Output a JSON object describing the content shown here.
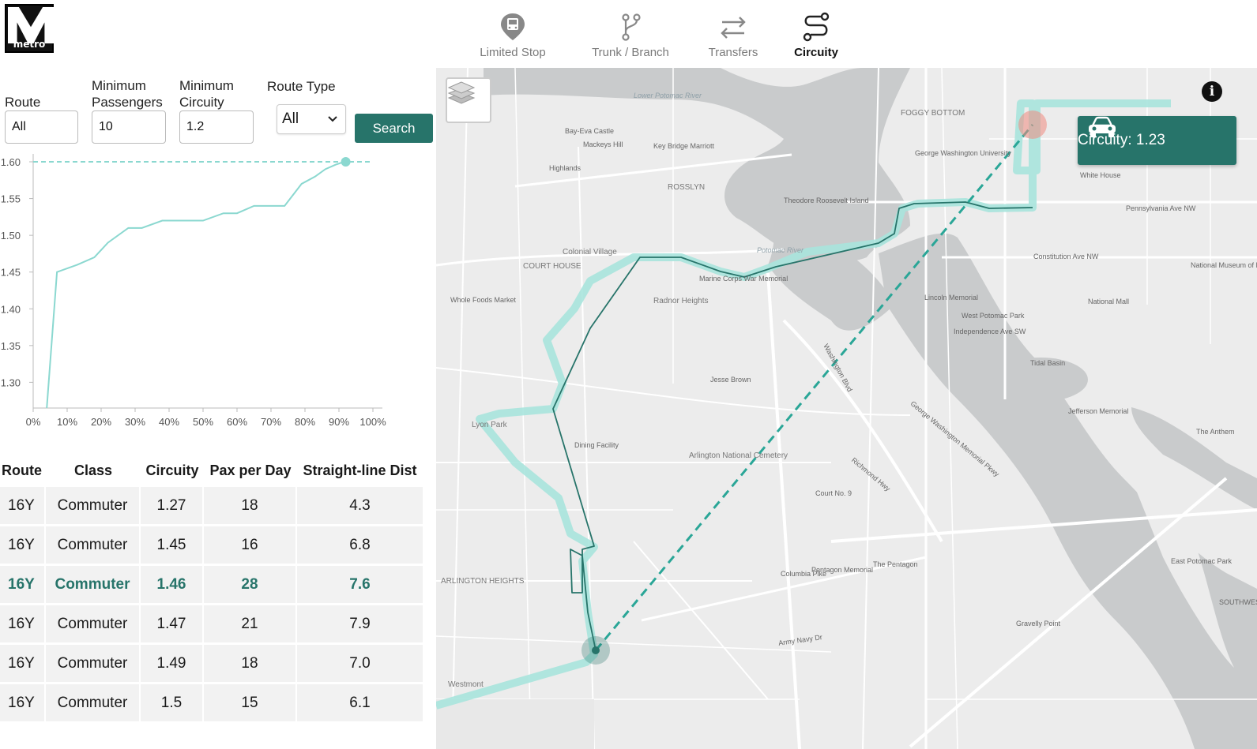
{
  "logo": {
    "letter": "M",
    "word": "metro"
  },
  "nav": [
    {
      "label": "Limited Stop",
      "icon": "bus-stop-pin-icon",
      "active": false
    },
    {
      "label": "Trunk / Branch",
      "icon": "branch-icon",
      "active": false
    },
    {
      "label": "Transfers",
      "icon": "transfer-arrows-icon",
      "active": false
    },
    {
      "label": "Circuity",
      "icon": "circuity-route-icon",
      "active": true
    }
  ],
  "filters": {
    "route_label": "Route",
    "route_value": "All",
    "min_pax_label_1": "Minimum",
    "min_pax_label_2": "Passengers",
    "min_pax_value": "10",
    "min_circ_label_1": "Minimum",
    "min_circ_label_2": "Circuity",
    "min_circ_value": "1.2",
    "route_type_label": "Route Type",
    "route_type_value": "All",
    "search_label": "Search"
  },
  "chart_data": {
    "type": "line",
    "title": "",
    "xlabel": "",
    "ylabel": "",
    "x_ticks": [
      "0%",
      "10%",
      "20%",
      "30%",
      "40%",
      "50%",
      "60%",
      "70%",
      "80%",
      "90%",
      "100%"
    ],
    "y_ticks": [
      "1.30",
      "1.35",
      "1.40",
      "1.45",
      "1.50",
      "1.55",
      "1.60"
    ],
    "xlim": [
      0,
      100
    ],
    "ylim": [
      1.265,
      1.6
    ],
    "grid": false,
    "x": [
      4,
      7,
      13,
      18,
      22,
      28,
      32,
      38,
      43,
      50,
      56,
      60,
      65,
      72,
      74,
      79,
      83,
      86,
      89,
      91.5
    ],
    "values": [
      1.265,
      1.45,
      1.46,
      1.47,
      1.49,
      1.51,
      1.51,
      1.52,
      1.52,
      1.52,
      1.53,
      1.53,
      1.54,
      1.54,
      1.54,
      1.57,
      1.58,
      1.59,
      1.596,
      1.6
    ],
    "reference_line": {
      "y": 1.6,
      "style": "dashed"
    },
    "highlight_point": {
      "x": 92,
      "y": 1.6
    },
    "color": "#8bd8d0"
  },
  "table": {
    "headers": [
      "Route",
      "Class",
      "Circuity",
      "Pax per Day",
      "Straight-line Dist"
    ],
    "rows": [
      [
        "16Y",
        "Commuter",
        "1.27",
        "18",
        "4.3"
      ],
      [
        "16Y",
        "Commuter",
        "1.45",
        "16",
        "6.8"
      ],
      [
        "16Y",
        "Commuter",
        "1.46",
        "28",
        "7.6"
      ],
      [
        "16Y",
        "Commuter",
        "1.47",
        "21",
        "7.9"
      ],
      [
        "16Y",
        "Commuter",
        "1.49",
        "18",
        "7.0"
      ],
      [
        "16Y",
        "Commuter",
        "1.5",
        "15",
        "6.1"
      ]
    ],
    "highlighted_row": 2
  },
  "map": {
    "badge_text": "Circuity: 1.23",
    "labels": {
      "foggy_bottom": "FOGGY BOTTOM",
      "rosslyn": "ROSSLYN",
      "court_house": "COURT HOUSE",
      "arlington_heights": "ARLINGTON HEIGHTS",
      "colonial_village": "Colonial Village",
      "radnor_heights": "Radnor Heights",
      "lyon_park": "Lyon Park",
      "arlington_cemetery": "Arlington National Cemetery",
      "westmont": "Westmont",
      "potomac_river": "Potomac River",
      "lower_potomac": "Lower Potomac River",
      "highlands": "Highlands",
      "lincoln_memorial": "Lincoln Memorial",
      "national_mall": "National Mall",
      "the_pentagon": "The Pentagon",
      "pentagon_memorial": "Pentagon Memorial",
      "tidal_basin": "Tidal Basin",
      "jefferson_memorial": "Jefferson Memorial",
      "theodore_roosevelt": "Theodore Roosevelt Island",
      "marine_corps": "Marine Corps War Memorial",
      "columbia_pike": "Columbia Pike",
      "southwest": "SOUTHWEST",
      "gwu": "George Washington University",
      "white_house": "White House",
      "dining_facility": "Dining Facility",
      "jesse_brown": "Jesse Brown",
      "court_no9": "Court No. 9",
      "whole_foods": "Whole Foods Market",
      "key_bridge_marriott": "Key Bridge Marriott",
      "bay_eva_castle": "Bay-Eva Castle",
      "mackeys_hill": "Mackeys Hill",
      "east_potomac_park": "East Potomac Park",
      "west_potomac_park": "West Potomac Park",
      "national_museum": "National Museum of Natural History",
      "constitution_ave": "Constitution Ave NW",
      "independence_ave": "Independence Ave SW",
      "pennsylvania_ave": "Pennsylvania Ave NW",
      "washington_blvd": "Washington Blvd",
      "richmond_hwy": "Richmond Hwy",
      "gw_memorial_pkwy": "George Washington Memorial Pkwy",
      "army_navy_dr": "Army Navy Dr",
      "gravelly_point": "Gravelly Point",
      "the_anthem": "The Anthem"
    }
  }
}
